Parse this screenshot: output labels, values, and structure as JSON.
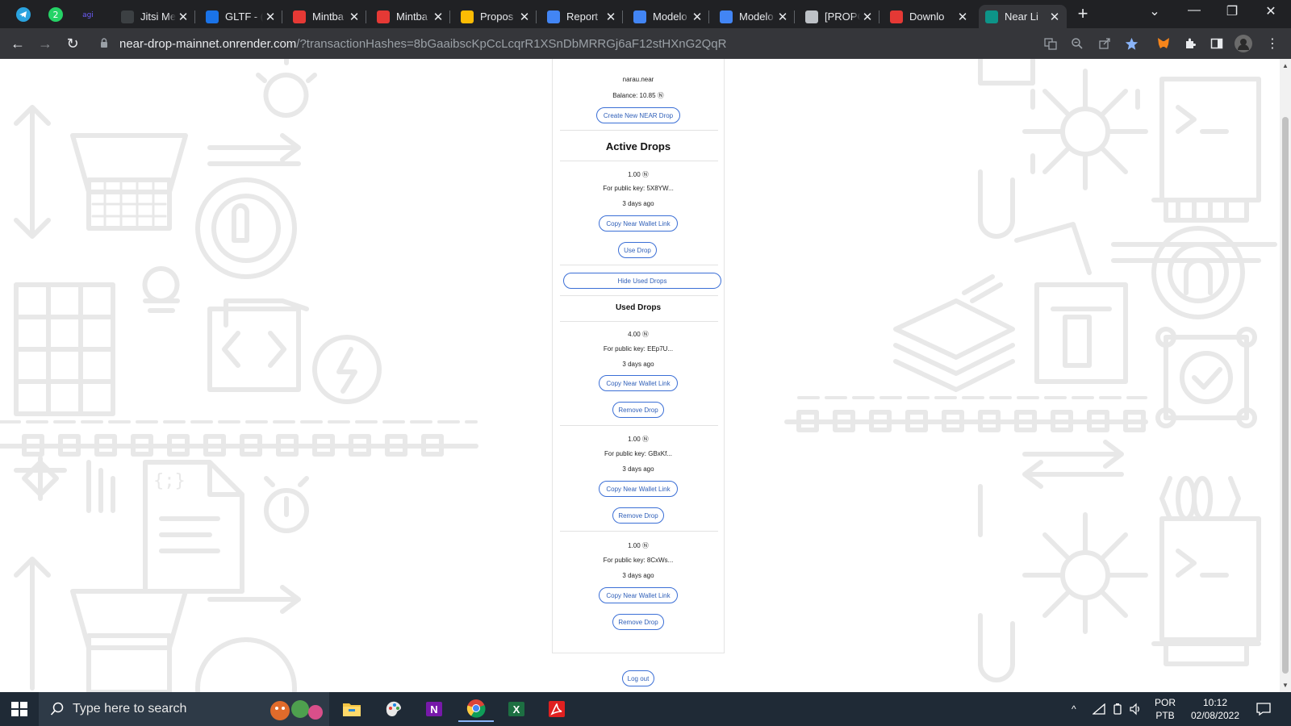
{
  "browser": {
    "tabs": [
      {
        "title": "Jitsi Me",
        "favicon": "feather-icon",
        "color": "#3c4043"
      },
      {
        "title": "GLTF - (",
        "favicon": "f-icon",
        "color": "#1a73e8"
      },
      {
        "title": "Mintba",
        "favicon": "mintbase-icon",
        "color": "#e53935"
      },
      {
        "title": "Mintba",
        "favicon": "mintbase-icon",
        "color": "#e53935"
      },
      {
        "title": "Propos",
        "favicon": "google-drive-icon",
        "color": "#fbbc04"
      },
      {
        "title": "Report",
        "favicon": "google-docs-icon",
        "color": "#4285f4"
      },
      {
        "title": "Modelo",
        "favicon": "google-docs-icon",
        "color": "#4285f4"
      },
      {
        "title": "Modelo",
        "favicon": "google-docs-icon",
        "color": "#4285f4"
      },
      {
        "title": "[PROPC",
        "favicon": "near-icon",
        "color": "#bdc1c6"
      },
      {
        "title": "Downlo",
        "favicon": "heart-icon",
        "color": "#e53935"
      },
      {
        "title": "Near Li",
        "favicon": "n-icon",
        "color": "#0d9488"
      }
    ],
    "url_host": "near-drop-mainnet.onrender.com",
    "url_rest": "/?transactionHashes=8bGaaibscKpCcLcqrR1XSnDbMRRGj6aF12stHXnG2QqR"
  },
  "account": {
    "name": "narau.near",
    "balance": "Balance: 10.85 Ⓝ",
    "create_button": "Create New NEAR Drop"
  },
  "active": {
    "heading": "Active Drops",
    "drops": [
      {
        "amount": "1.00 Ⓝ",
        "key": "For public key: 5X8YW...",
        "age": "3 days ago",
        "copy": "Copy Near Wallet Link",
        "action": "Use Drop"
      }
    ]
  },
  "hide_used_button": "Hide Used Drops",
  "used": {
    "heading": "Used Drops",
    "drops": [
      {
        "amount": "4.00 Ⓝ",
        "key": "For public key: EEp7U...",
        "age": "3 days ago",
        "copy": "Copy Near Wallet Link",
        "action": "Remove Drop"
      },
      {
        "amount": "1.00 Ⓝ",
        "key": "For public key: GBxKf...",
        "age": "3 days ago",
        "copy": "Copy Near Wallet Link",
        "action": "Remove Drop"
      },
      {
        "amount": "1.00 Ⓝ",
        "key": "For public key: 8CxWs...",
        "age": "3 days ago",
        "copy": "Copy Near Wallet Link",
        "action": "Remove Drop"
      }
    ]
  },
  "logout_button": "Log out",
  "taskbar": {
    "search_placeholder": "Type here to search",
    "lang_top": "POR",
    "lang_bottom": "PTB",
    "time": "10:12",
    "date": "02/08/2022"
  }
}
